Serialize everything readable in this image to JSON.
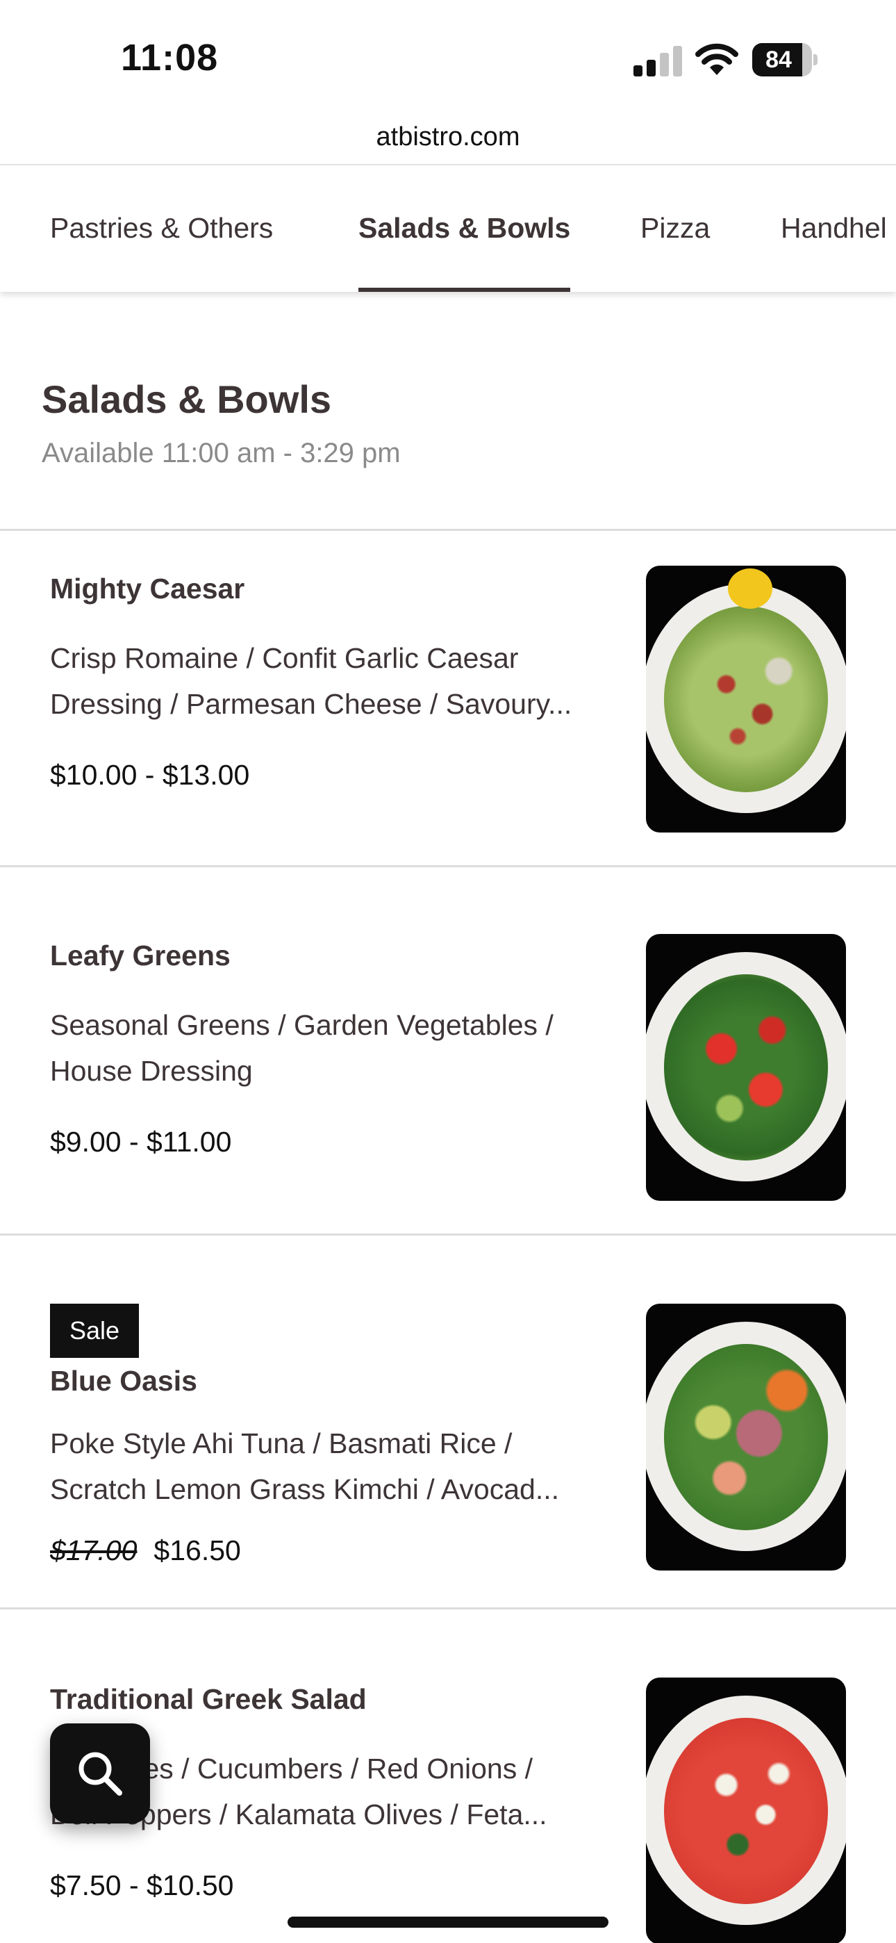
{
  "status_bar": {
    "time": "11:08",
    "battery_level": "84",
    "icons": [
      "cellular-signal-icon",
      "wifi-icon",
      "battery-icon"
    ]
  },
  "browser": {
    "url": "atbistro.com"
  },
  "tabs": [
    {
      "label": "Pastries & Others",
      "active": false
    },
    {
      "label": "Salads & Bowls",
      "active": true
    },
    {
      "label": "Pizza",
      "active": false
    },
    {
      "label": "Handhel",
      "active": false
    }
  ],
  "section": {
    "title": "Salads & Bowls",
    "availability": "Available 11:00 am - 3:29 pm"
  },
  "items": [
    {
      "name": "Mighty Caesar",
      "desc_line1": "Crisp Romaine / Confit Garlic Caesar",
      "desc_line2": "Dressing / Parmesan Cheese / Savoury...",
      "price": "$10.00 - $13.00"
    },
    {
      "name": "Leafy Greens",
      "desc_line1": "Seasonal Greens / Garden Vegetables /",
      "desc_line2": "House Dressing",
      "price": "$9.00 - $11.00"
    },
    {
      "badge": "Sale",
      "name": "Blue Oasis",
      "desc_line1": "Poke Style Ahi Tuna / Basmati Rice /",
      "desc_line2": "Scratch Lemon Grass Kimchi / Avocad...",
      "price_original": "$17.00",
      "price_sale": "$16.50"
    },
    {
      "name": "Traditional Greek Salad",
      "desc_line1": "Tomatoes / Cucumbers / Red Onions /",
      "desc_line2": "Bell Peppers / Kalamata Olives / Feta...",
      "price": "$7.50 - $10.50"
    }
  ],
  "colors": {
    "text_primary": "#3d3436",
    "text_muted": "#8a8a8a",
    "divider": "#dcdcdc",
    "badge_bg": "#111111",
    "image_bg": "#050505"
  },
  "search_button": {
    "icon": "search-icon"
  }
}
